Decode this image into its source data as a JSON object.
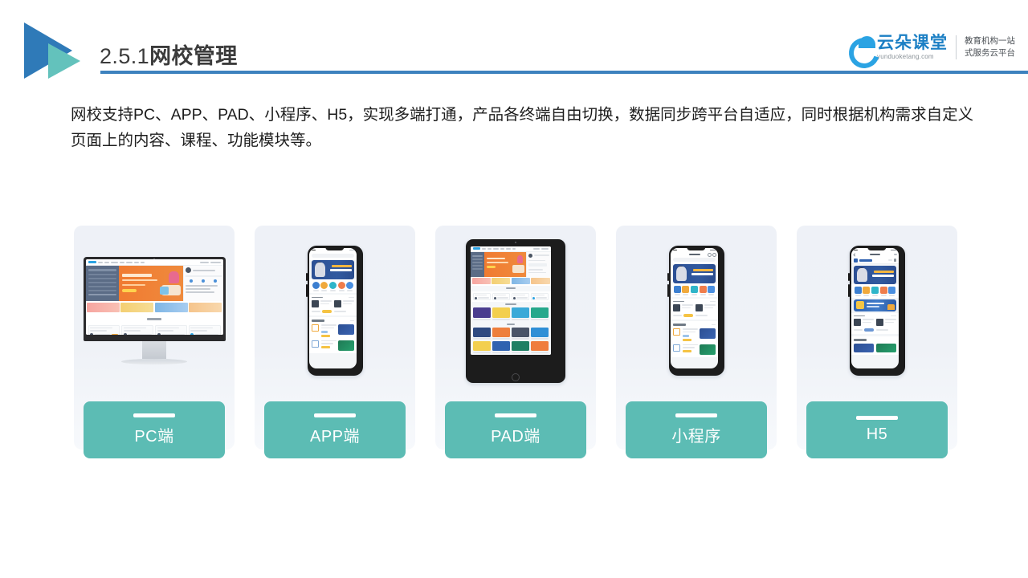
{
  "header": {
    "title_number": "2.5.1",
    "title_text": "网校管理",
    "logo_icon": "double-triangle-logo",
    "rule_color": "#3d82be"
  },
  "brand": {
    "cloud_icon": "cloud-icon",
    "name_cn": "云朵课堂",
    "name_en": "yunduoketang.com",
    "tagline_line1": "教育机构一站",
    "tagline_line2": "式服务云平台",
    "accent_color": "#1b7fc4"
  },
  "body": {
    "paragraph": "网校支持PC、APP、PAD、小程序、H5，实现多端打通，产品各终端自由切换，数据同步跨平台自适应，同时根据机构需求自定义页面上的内容、课程、功能模块等。"
  },
  "cards": {
    "accent_color": "#5cbcb4",
    "bg_color": "#eef1f7",
    "items": [
      {
        "label": "PC端",
        "device": "desktop-monitor"
      },
      {
        "label": "APP端",
        "device": "mobile-phone"
      },
      {
        "label": "PAD端",
        "device": "tablet"
      },
      {
        "label": "小程序",
        "device": "mobile-phone"
      },
      {
        "label": "H5",
        "device": "mobile-phone"
      }
    ]
  }
}
